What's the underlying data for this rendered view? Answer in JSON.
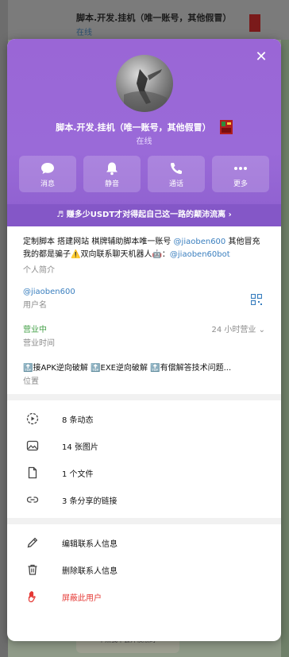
{
  "background": {
    "chat_title": "脚本.开发.挂机（唯一账号，其他假冒）",
    "chat_subtitle": "在线",
    "bottom_message": "不然我不会开权限的",
    "bottom_time": "20:17"
  },
  "profile": {
    "name": "脚本.开发.挂机（唯一账号，其他假冒）",
    "status": "在线"
  },
  "actions": [
    {
      "label": "消息",
      "icon": "message-icon"
    },
    {
      "label": "静音",
      "icon": "bell-icon"
    },
    {
      "label": "通话",
      "icon": "phone-icon"
    },
    {
      "label": "更多",
      "icon": "more-icon"
    }
  ],
  "banner": "♬ 赚多少USDT才对得起自己这一路的颠沛流离 ›",
  "bio": {
    "text_1": "定制脚本 搭建网站 棋牌辅助脚本唯一账号 ",
    "link_1": "@jiaoben600",
    "text_2": " 其他冒充我的都是骗子⚠️双向联系聊天机器人🤖：",
    "link_2": "@jiaoben60bot",
    "label": "个人简介"
  },
  "username": {
    "value": "@jiaoben600",
    "label": "用户名"
  },
  "business": {
    "value": "营业中",
    "label": "营业时间",
    "hours": "24 小时营业 ⌄"
  },
  "location": {
    "value": "🔝接APK逆向破解 🔝EXE逆向破解 🔝有偿解答技术问题...",
    "label": "位置"
  },
  "media": [
    {
      "label": "8 条动态",
      "icon": "stories-icon"
    },
    {
      "label": "14 张图片",
      "icon": "image-icon"
    },
    {
      "label": "1 个文件",
      "icon": "file-icon"
    },
    {
      "label": "3 条分享的链接",
      "icon": "link-icon"
    }
  ],
  "manage": [
    {
      "label": "编辑联系人信息",
      "icon": "pencil-icon"
    },
    {
      "label": "删除联系人信息",
      "icon": "trash-icon"
    },
    {
      "label": "屏蔽此用户",
      "icon": "block-hand-icon"
    }
  ],
  "colors": {
    "header": "#9a66d6",
    "link": "#3a7fbf",
    "online": "#43a047",
    "danger": "#e53935"
  }
}
